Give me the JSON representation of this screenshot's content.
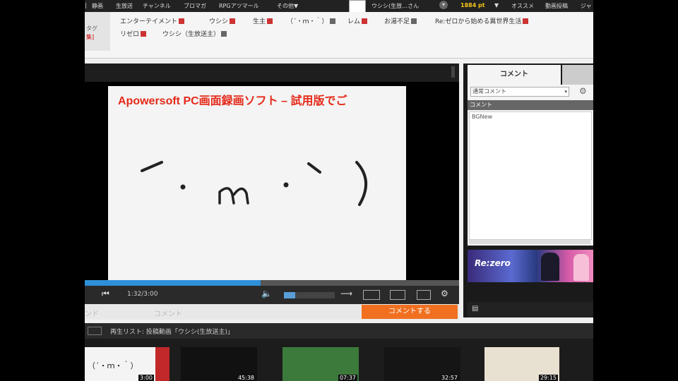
{
  "top_nav": {
    "items": [
      "静画",
      "生放送",
      "チャンネル",
      "ブロマガ",
      "RPGアツマール",
      "その他▼"
    ],
    "user_greeting": "ウシシ(生放…さん",
    "points": "1884 pt",
    "right_items": [
      "オススメ",
      "動画投稿",
      "ジャ"
    ]
  },
  "tag_area": {
    "lock_label": "タグ",
    "lock_sub": "集]",
    "row1": [
      {
        "label": "エンターテイメント",
        "icon": "red"
      },
      {
        "label": "ウシシ",
        "icon": "red"
      },
      {
        "label": "生主",
        "icon": "red"
      },
      {
        "label": "（´・ｍ・｀）",
        "icon": "gray"
      },
      {
        "label": "レム",
        "icon": "red"
      },
      {
        "label": "お湯不足",
        "icon": "gray"
      },
      {
        "label": "Re:ゼロから始める異世界生活",
        "icon": "red"
      }
    ],
    "row2": [
      {
        "label": "リゼロ",
        "icon": "red"
      },
      {
        "label": "ウシシ（生放送主）",
        "icon": "gray"
      }
    ]
  },
  "player": {
    "watermark": "Apowersoft PC画面録画ソフト – 試用版でご",
    "drawn_text": "（´・ｍ・｀）",
    "time": "1:32/3:00",
    "progress": 0.47,
    "volume": 0.22,
    "comment_placeholder": "コメント",
    "comment_left_fragment": "ンド",
    "comment_submit": "コメントする"
  },
  "right_panel": {
    "tab_label": "コメント",
    "select_value": "通常コメント",
    "list_header": "コメント",
    "list_item": "BGNew",
    "ad_text": "Re:zero"
  },
  "playlist": {
    "label": "再生リスト: 投稿動画「ウシシ(生放送主)」",
    "thumbnails": [
      {
        "caption": "（´・ｍ・｀）",
        "duration": "3:00",
        "bg": "#f4f4f4",
        "frame": "#c0282a"
      },
      {
        "caption": "",
        "duration": "45:38",
        "bg": "#111111",
        "frame": ""
      },
      {
        "caption": "",
        "duration": "07:37",
        "bg": "#3b7a3a",
        "frame": ""
      },
      {
        "caption": "",
        "duration": "32:57",
        "bg": "#151515",
        "frame": ""
      },
      {
        "caption": "",
        "duration": "29:15",
        "bg": "#e8e0d0",
        "frame": ""
      }
    ]
  },
  "colors": {
    "accent_orange": "#f07020",
    "progress_blue": "#2f8fd8",
    "watermark_red": "#e52a1a"
  }
}
